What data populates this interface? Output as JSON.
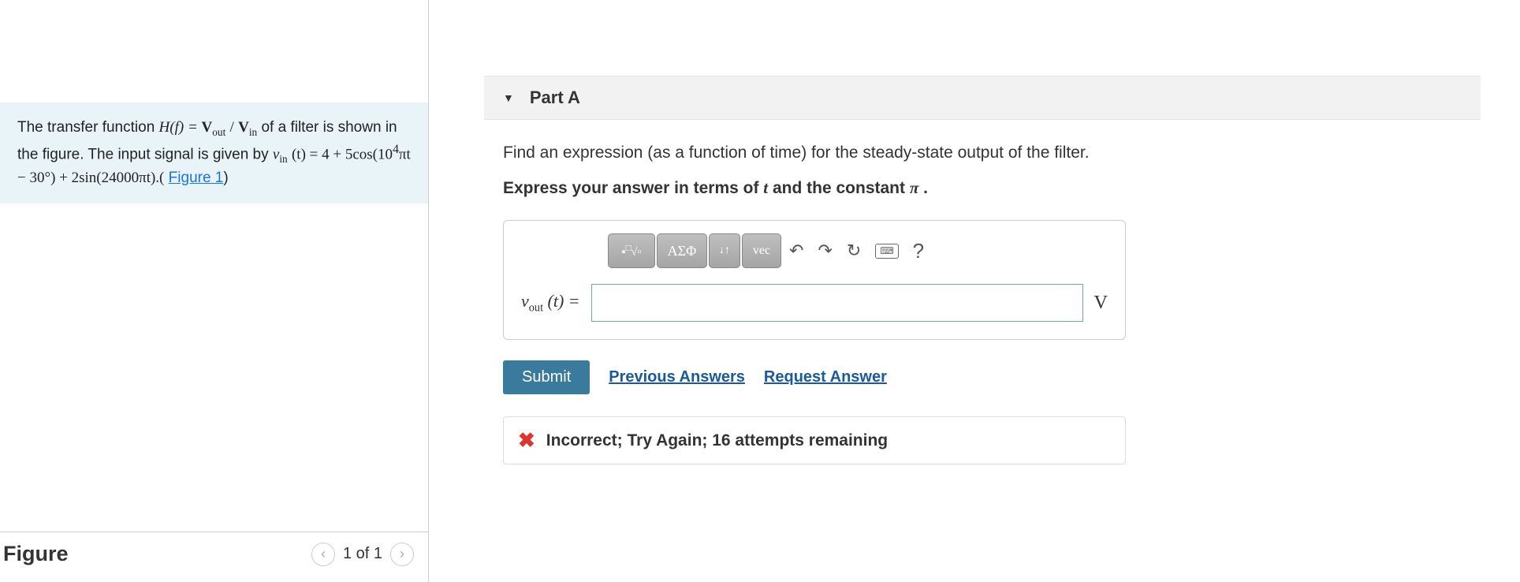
{
  "problem": {
    "text_prefix": "The transfer function ",
    "hf": "H(f) = ",
    "vout_sym": "V",
    "vout_sub": "out",
    "slash": "/",
    "vin_sym": "V",
    "vin_sub": "in",
    "text_mid1": " of a filter is shown in the figure. The input signal is given by ",
    "vin_eq": "v",
    "vin_eq_sub": "in",
    "vin_eq_rest": "(t) = 4 + 5cos(10",
    "sup4": "4",
    "vin_eq_rest2": "πt − 30°) + 2sin(24000πt).(",
    "figure_link": "Figure 1",
    "close_paren": ")"
  },
  "figure": {
    "title": "Figure",
    "page_indicator": "1 of 1"
  },
  "part": {
    "title": "Part A"
  },
  "question": {
    "prompt": "Find an expression (as a function of time) for the steady-state output of the filter.",
    "instruction_prefix": "Express your answer in terms of ",
    "instruction_var1": "t",
    "instruction_mid": " and the constant ",
    "instruction_var2": "π",
    "instruction_suffix": "."
  },
  "toolbar": {
    "templates": "√",
    "greek": "ΑΣΦ",
    "subscript": "↓↑",
    "vec": "vec",
    "undo": "↶",
    "redo": "↷",
    "reset": "↻",
    "keyboard": "⌨",
    "help": "?"
  },
  "answer": {
    "lhs_var": "v",
    "lhs_sub": "out",
    "lhs_paren": "(t) =",
    "value": "",
    "unit": "V"
  },
  "actions": {
    "submit": "Submit",
    "previous": "Previous Answers",
    "request": "Request Answer"
  },
  "feedback": {
    "icon": "✖",
    "message": "Incorrect; Try Again; 16 attempts remaining"
  }
}
